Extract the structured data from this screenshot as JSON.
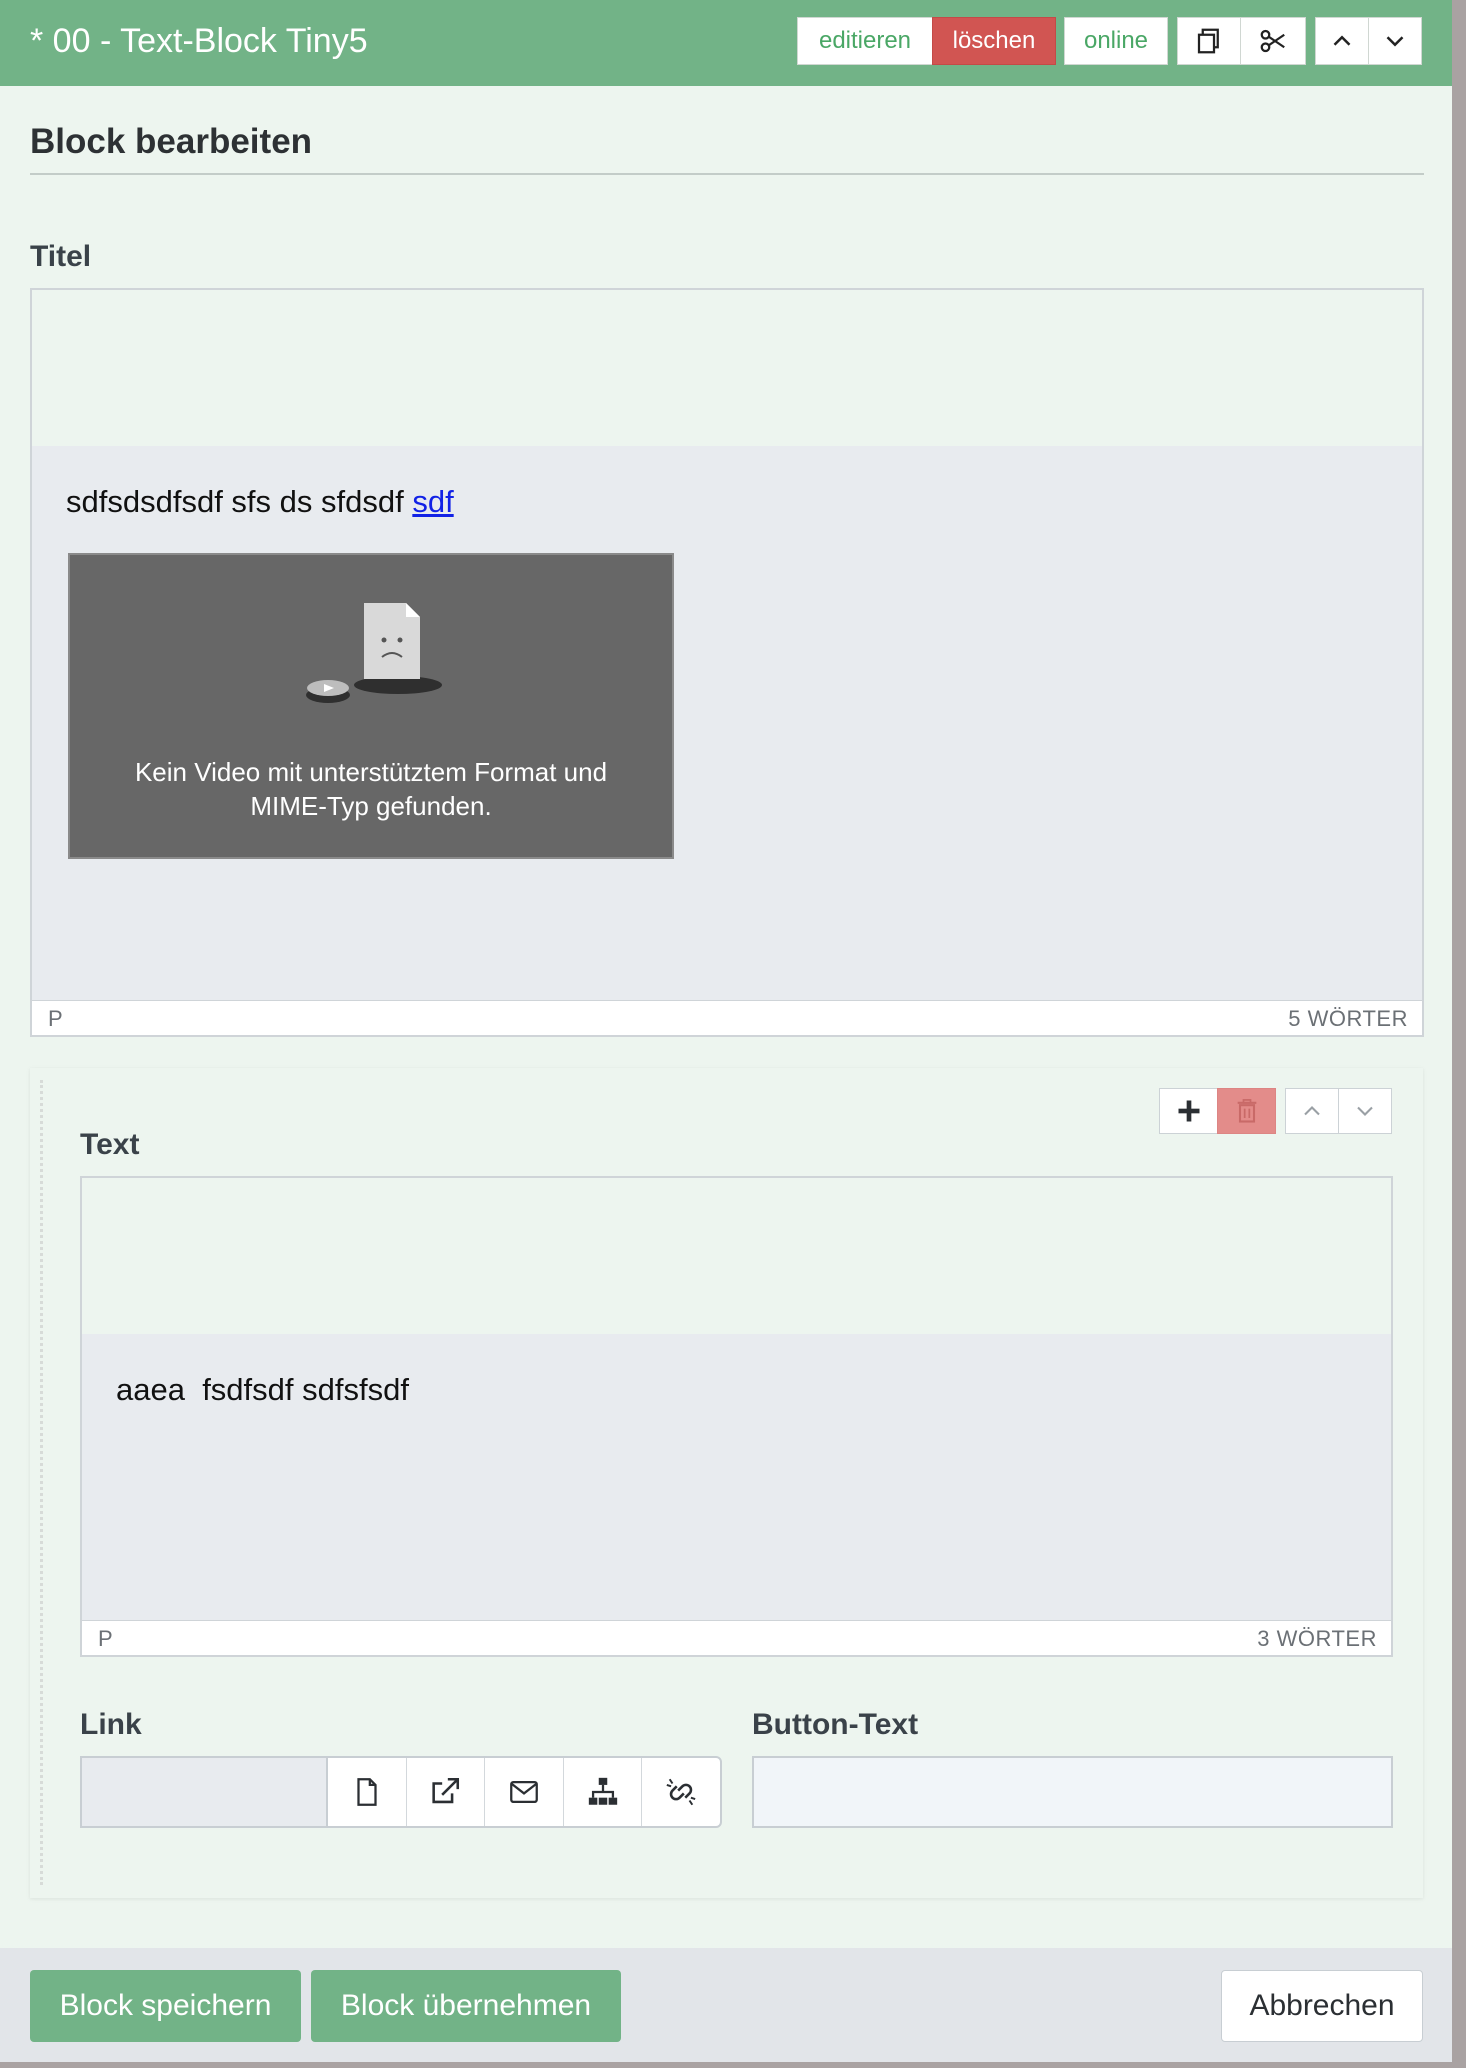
{
  "header": {
    "title": "* 00 - Text-Block Tiny5",
    "edit_label": "editieren",
    "delete_label": "löschen",
    "status_label": "online"
  },
  "form": {
    "heading": "Block bearbeiten",
    "title_field": {
      "label": "Titel",
      "content_text": "sdfsdsdfsdf sfs ds sfdsdf ",
      "content_link": "sdf",
      "video_message_line1": "Kein Video mit unterstütztem Format und",
      "video_message_line2": "MIME-Typ gefunden.",
      "status_path": "P",
      "word_count": "5 WÖRTER"
    },
    "repeater": {
      "text_field": {
        "label": "Text",
        "content_text": "aaea  fsdfsdf sdfsfsdf",
        "status_path": "P",
        "word_count": "3 WÖRTER"
      },
      "link_field": {
        "label": "Link",
        "value": ""
      },
      "button_text_field": {
        "label": "Button-Text",
        "value": ""
      }
    }
  },
  "footer": {
    "save_label": "Block speichern",
    "apply_label": "Block übernehmen",
    "cancel_label": "Abbrechen"
  },
  "colors": {
    "header_green": "#72b387",
    "danger_red": "#d15552",
    "panel_bg": "#edf5ef",
    "link_blue": "#1222e6"
  },
  "icons": {
    "copy": "copy-icon",
    "cut": "scissors-icon",
    "move_up": "chevron-up-icon",
    "move_down": "chevron-down-icon",
    "add": "plus-icon",
    "delete": "trash-icon",
    "internal_link": "file-icon",
    "external_link": "external-link-icon",
    "mail_link": "envelope-icon",
    "sitemap_link": "sitemap-icon",
    "unlink": "unlink-icon"
  }
}
